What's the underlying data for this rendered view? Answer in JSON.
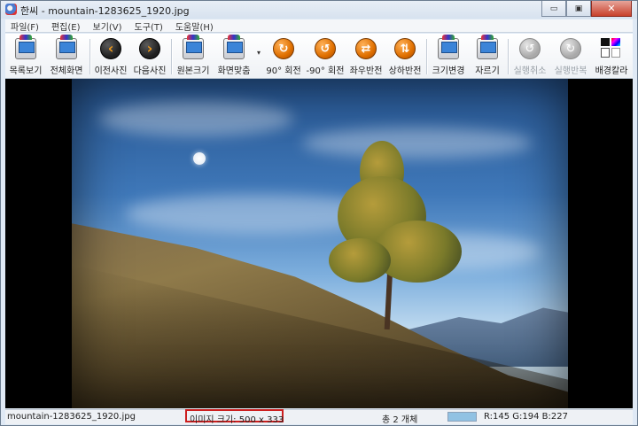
{
  "window": {
    "title": "한씨 - mountain-1283625_1920.jpg",
    "minimize_glyph": "▭",
    "restore_glyph": "▣",
    "close_glyph": "✕"
  },
  "menu": [
    "파일(F)",
    "편집(E)",
    "보기(V)",
    "도구(T)",
    "도움말(H)"
  ],
  "toolbar": {
    "list_view": "목록보기",
    "full_screen": "전체화면",
    "prev_photo": "이전사진",
    "next_photo": "다음사진",
    "original_size": "원본크기",
    "fit_screen": "화면맞춤",
    "rotate_90": "90° 회전",
    "rotate_minus_90": "-90° 회전",
    "flip_horizontal": "좌우반전",
    "flip_vertical": "상하반전",
    "resize": "크기변경",
    "crop": "자르기",
    "undo": "실행취소",
    "redo": "실행반복",
    "bg_color": "배경칼라"
  },
  "icons": {
    "prev": "‹",
    "next": "›",
    "rotate_cw": "↻",
    "rotate_ccw": "↺",
    "flip_h": "⇄",
    "flip_v": "⇅",
    "dropdown": "▾"
  },
  "status": {
    "filename": "mountain-1283625_1920.jpg",
    "image_size": "이미지 크기: 500 x 333",
    "count": "총 2 개체",
    "rgb": "R:145 G:194 B:227",
    "swatch_color": "#91c2e3",
    "highlight_color": "#cc1f1f"
  }
}
